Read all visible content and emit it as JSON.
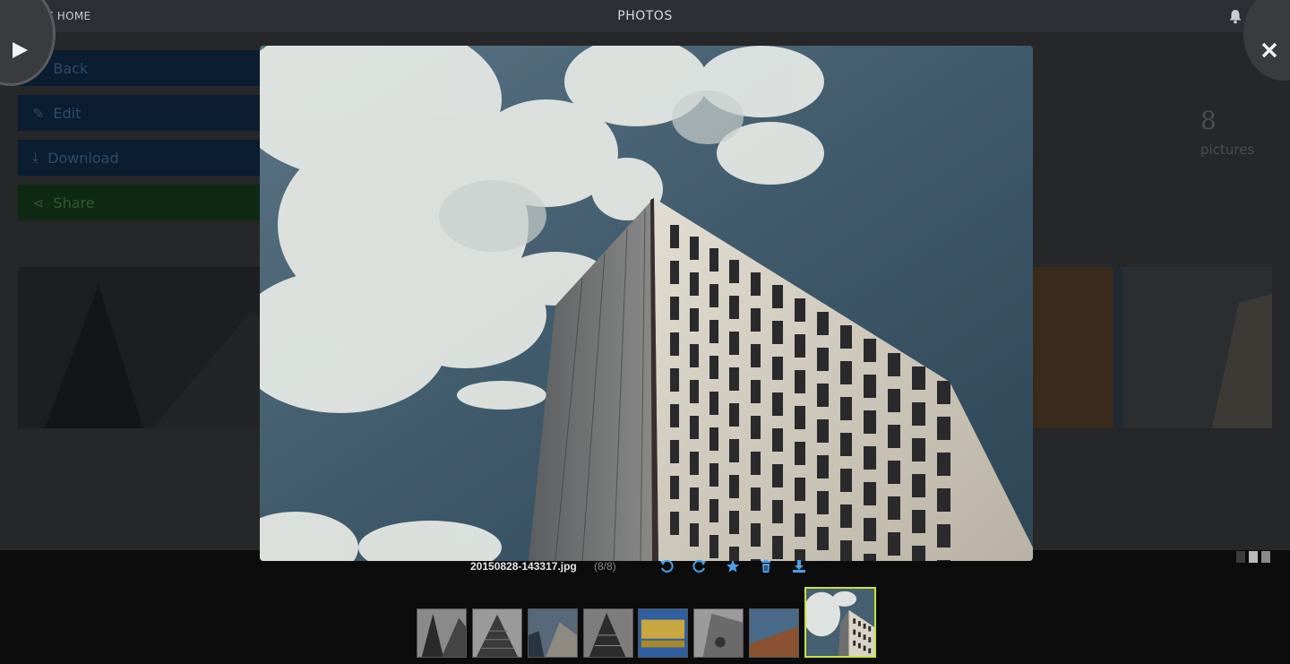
{
  "topbar": {
    "back_label": "BACK HOME",
    "title": "PHOTOS",
    "icons": [
      "chevron-left-icon",
      "bell-icon",
      "sign-out-icon"
    ]
  },
  "background": {
    "buttons": [
      {
        "label": "Back",
        "icon": "arrow-left-icon"
      },
      {
        "label": "Edit",
        "icon": "edit-icon"
      },
      {
        "label": "Download",
        "icon": "download-icon"
      },
      {
        "label": "Share",
        "icon": "share-icon"
      }
    ],
    "picture_count": "8",
    "picture_count_label": "pictures"
  },
  "viewer": {
    "filename": "20150828-143317.jpg",
    "counter": "(8/8)",
    "controls": [
      "rotate-left-icon",
      "rotate-right-icon",
      "star-icon",
      "trash-icon",
      "download-icon"
    ],
    "accent_color": "#4a9fe8",
    "active_thumb_border": "#c5e33a",
    "thumbnails_count": 8,
    "active_index": 8
  }
}
